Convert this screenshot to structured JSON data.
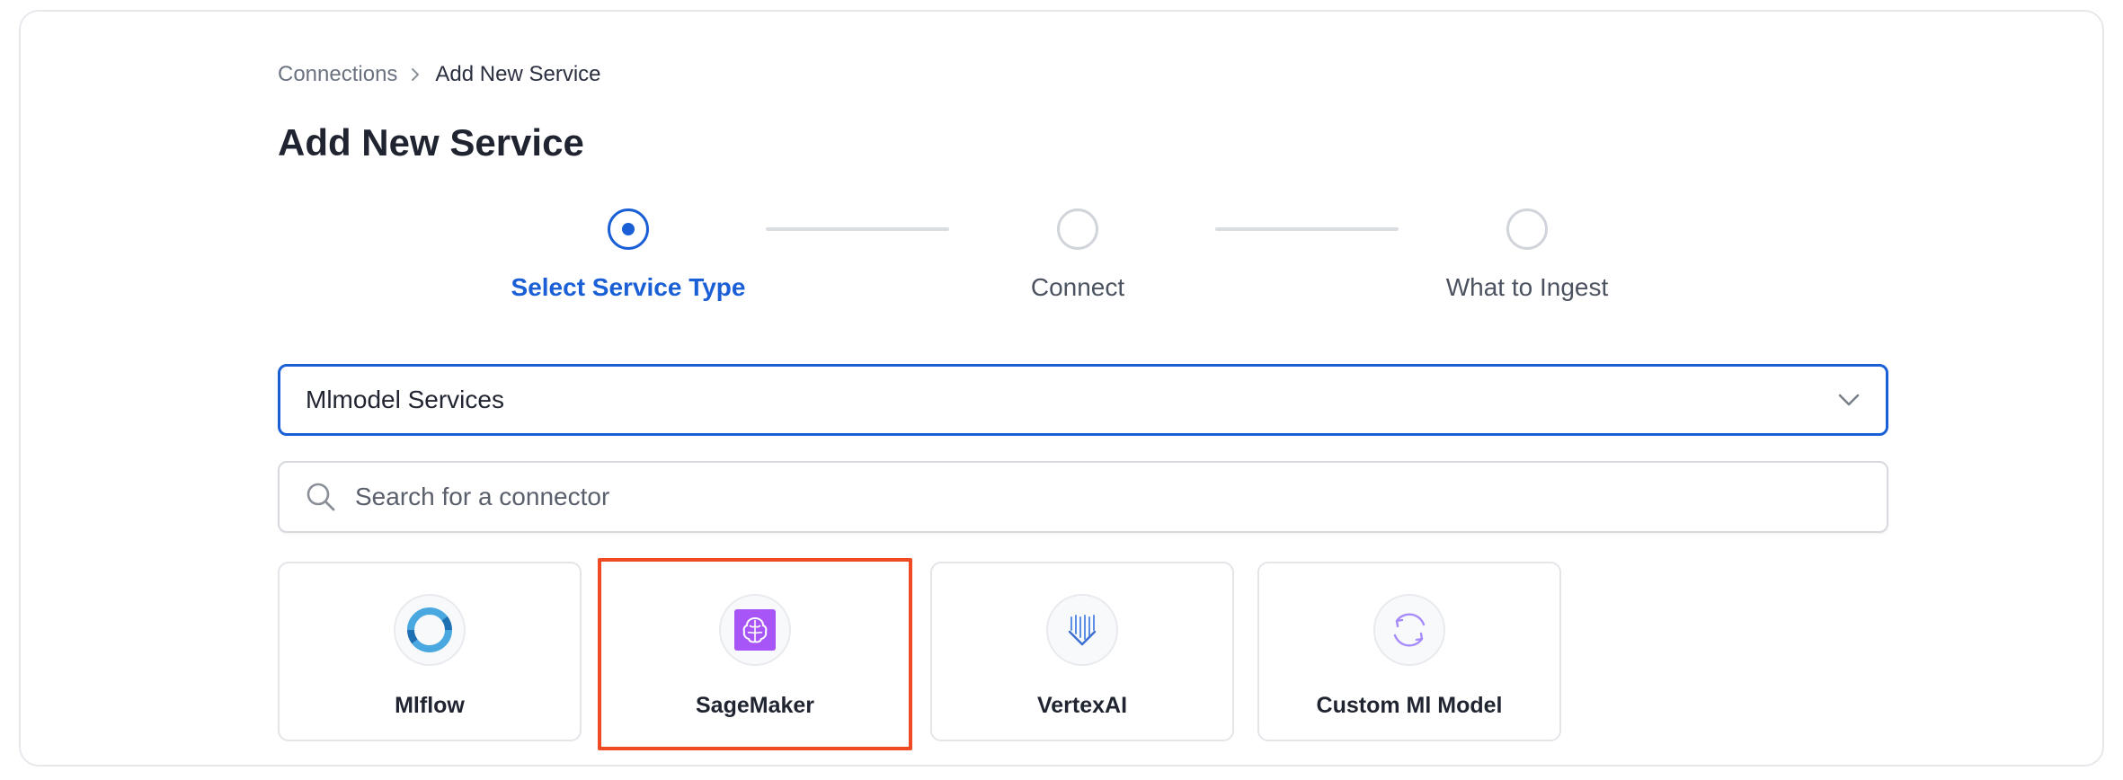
{
  "breadcrumb": {
    "items": [
      "Connections",
      "Add New Service"
    ]
  },
  "page": {
    "title": "Add New Service"
  },
  "stepper": {
    "steps": [
      {
        "label": "Select Service Type",
        "state": "active"
      },
      {
        "label": "Connect",
        "state": "pending"
      },
      {
        "label": "What to Ingest",
        "state": "pending"
      }
    ]
  },
  "service_type_select": {
    "value": "Mlmodel Services"
  },
  "search": {
    "placeholder": "Search for a connector",
    "value": ""
  },
  "connectors": [
    {
      "name": "Mlflow",
      "icon": "mlflow-icon"
    },
    {
      "name": "SageMaker",
      "icon": "sagemaker-icon",
      "selected": true
    },
    {
      "name": "VertexAI",
      "icon": "vertexai-icon"
    },
    {
      "name": "Custom Ml Model",
      "icon": "custom-ml-model-icon"
    }
  ],
  "colors": {
    "accent": "#1a5fd6",
    "highlight": "#f04a23",
    "sagemaker": "#a855f7",
    "mlflow": "#4aa8e0"
  }
}
